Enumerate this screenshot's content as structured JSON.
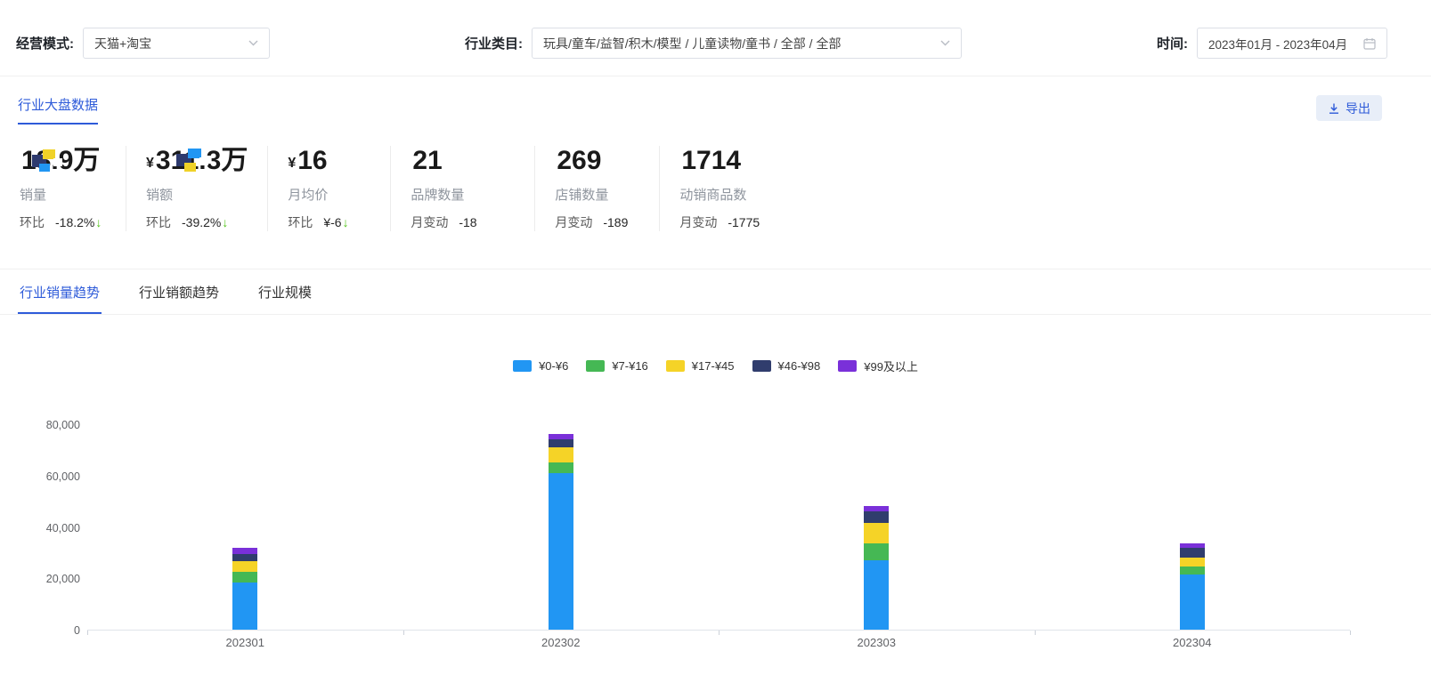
{
  "theme": {
    "accent": "#2e5bd9",
    "down_arrow_green": "#52c41a",
    "export_button_bg": "#e8eef8",
    "divider": "#f0f0f0"
  },
  "topbar": {
    "mode_label": "经营模式:",
    "mode_value": "天猫+淘宝",
    "category_label": "行业类目:",
    "category_value": "玩具/童车/益智/积木/模型 / 儿童读物/童书 / 全部 / 全部",
    "time_label": "时间:",
    "time_value": "2023年01月 - 2023年04月"
  },
  "overview": {
    "tab_label": "行业大盘数据",
    "export_label": "导出"
  },
  "kpis": [
    {
      "currency": "",
      "value": "18.9万",
      "label": "销量",
      "sub_label": "环比",
      "sub_value": "-18.2%",
      "arrow": "↓"
    },
    {
      "currency": "¥",
      "value": "311.3万",
      "label": "销额",
      "sub_label": "环比",
      "sub_value": "-39.2%",
      "arrow": "↓"
    },
    {
      "currency": "¥",
      "value": "16",
      "label": "月均价",
      "sub_label": "环比",
      "sub_value": "¥-6",
      "arrow": "↓"
    },
    {
      "currency": "",
      "value": "21",
      "label": "品牌数量",
      "sub_label": "月变动",
      "sub_value": "-18",
      "arrow": ""
    },
    {
      "currency": "",
      "value": "269",
      "label": "店铺数量",
      "sub_label": "月变动",
      "sub_value": "-189",
      "arrow": ""
    },
    {
      "currency": "",
      "value": "1714",
      "label": "动销商品数",
      "sub_label": "月变动",
      "sub_value": "-1775",
      "arrow": ""
    }
  ],
  "trend_tabs": [
    {
      "label": "行业销量趋势",
      "active": true
    },
    {
      "label": "行业销额趋势",
      "active": false
    },
    {
      "label": "行业规模",
      "active": false
    }
  ],
  "chart_data": {
    "type": "bar",
    "stacked": true,
    "title": "",
    "xlabel": "",
    "ylabel": "",
    "grid": false,
    "legend_position": "top-center",
    "categories": [
      "202301",
      "202302",
      "202303",
      "202304"
    ],
    "series": [
      {
        "name": "¥0-¥6",
        "color": "#2196f3",
        "values": [
          18500,
          61000,
          27000,
          21500
        ]
      },
      {
        "name": "¥7-¥16",
        "color": "#45b854",
        "values": [
          4000,
          4000,
          6500,
          3000
        ]
      },
      {
        "name": "¥17-¥45",
        "color": "#f5d327",
        "values": [
          4000,
          6000,
          8000,
          3500
        ]
      },
      {
        "name": "¥46-¥98",
        "color": "#303d6d",
        "values": [
          3000,
          3000,
          4500,
          3800
        ]
      },
      {
        "name": "¥99及以上",
        "color": "#7a30d9",
        "values": [
          2500,
          2200,
          2000,
          1700
        ]
      }
    ],
    "ylim": [
      0,
      80000
    ],
    "yticks": [
      0,
      20000,
      40000,
      60000,
      80000
    ]
  }
}
